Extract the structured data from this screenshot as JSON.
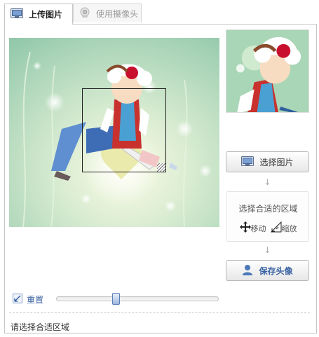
{
  "tabs": [
    {
      "label": "上传图片",
      "icon": "picture-icon",
      "active": true
    },
    {
      "label": "使用摄像头",
      "icon": "webcam-icon",
      "active": false
    }
  ],
  "buttons": {
    "select_image": "选择图片",
    "save_avatar": "保存头像"
  },
  "hint": {
    "title": "选择合适的区域",
    "move": "移动",
    "zoom": "缩放"
  },
  "arrows": {
    "down": "↓"
  },
  "reset_label": "重置",
  "zoom_slider": {
    "value": 0.36
  },
  "status_text": "请选择合适区域",
  "colors": {
    "accent": "#3a62a2",
    "border": "#c6c6c6"
  }
}
